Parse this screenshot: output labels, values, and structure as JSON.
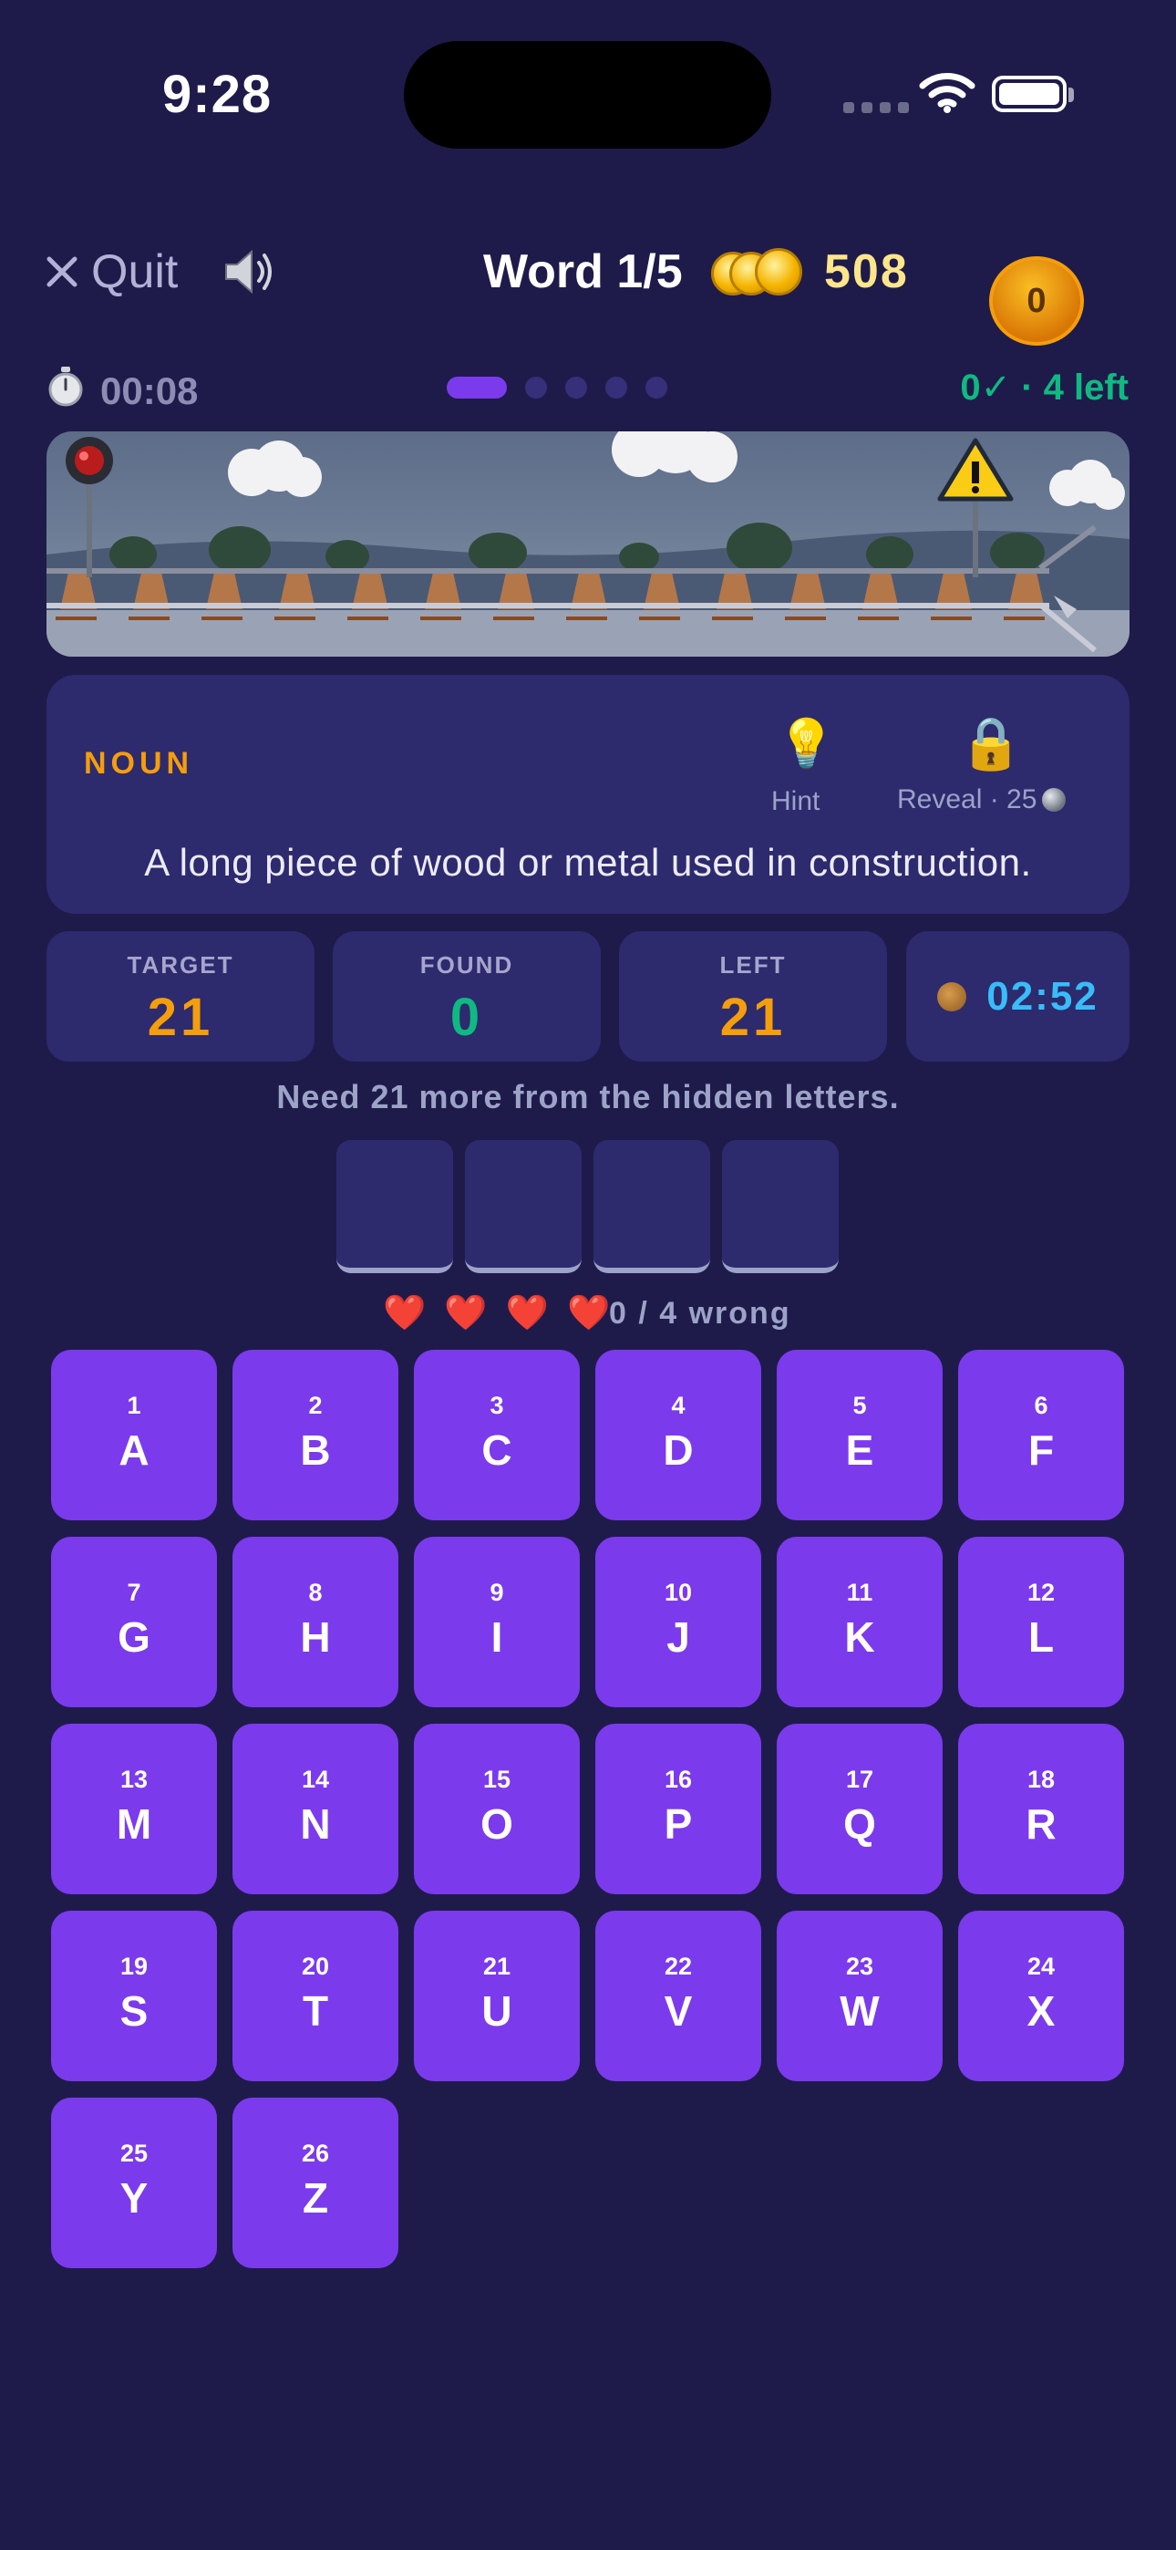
{
  "status_bar": {
    "time": "9:28"
  },
  "header": {
    "quit_label": "Quit",
    "word_title": "Word 1/5",
    "coin_count": "508",
    "badge_count": "0"
  },
  "progress": {
    "timer": "00:08",
    "status": "0✓ · 4 left",
    "current_word": 1,
    "total_words": 5
  },
  "card": {
    "part_of_speech": "NOUN",
    "hint_label": "Hint",
    "reveal_label": "Reveal · 25",
    "definition": "A long piece of wood or metal used in construction."
  },
  "stats": {
    "target_label": "TARGET",
    "target_value": "21",
    "found_label": "FOUND",
    "found_value": "0",
    "left_label": "LEFT",
    "left_value": "21",
    "countdown": "02:52"
  },
  "need_text": "Need 21 more from the hidden letters.",
  "answer_slots": 4,
  "lives": {
    "hearts": 4,
    "wrong_text": "0 / 4 wrong"
  },
  "keyboard": [
    {
      "n": "1",
      "l": "A"
    },
    {
      "n": "2",
      "l": "B"
    },
    {
      "n": "3",
      "l": "C"
    },
    {
      "n": "4",
      "l": "D"
    },
    {
      "n": "5",
      "l": "E"
    },
    {
      "n": "6",
      "l": "F"
    },
    {
      "n": "7",
      "l": "G"
    },
    {
      "n": "8",
      "l": "H"
    },
    {
      "n": "9",
      "l": "I"
    },
    {
      "n": "10",
      "l": "J"
    },
    {
      "n": "11",
      "l": "K"
    },
    {
      "n": "12",
      "l": "L"
    },
    {
      "n": "13",
      "l": "M"
    },
    {
      "n": "14",
      "l": "N"
    },
    {
      "n": "15",
      "l": "O"
    },
    {
      "n": "16",
      "l": "P"
    },
    {
      "n": "17",
      "l": "Q"
    },
    {
      "n": "18",
      "l": "R"
    },
    {
      "n": "19",
      "l": "S"
    },
    {
      "n": "20",
      "l": "T"
    },
    {
      "n": "21",
      "l": "U"
    },
    {
      "n": "22",
      "l": "V"
    },
    {
      "n": "23",
      "l": "W"
    },
    {
      "n": "24",
      "l": "X"
    },
    {
      "n": "25",
      "l": "Y"
    },
    {
      "n": "26",
      "l": "Z"
    }
  ],
  "colors": {
    "background": "#1e1b4b",
    "card": "#2d2a6e",
    "key": "#7c3aed",
    "accent_orange": "#f59e0b",
    "accent_green": "#10b981",
    "accent_blue": "#38bdf8"
  },
  "icons": {
    "quit": "close-icon",
    "sound": "speaker-icon",
    "timer": "stopwatch-icon",
    "hint": "lightbulb-icon",
    "reveal": "lock-icon",
    "lives": "heart-icon"
  }
}
